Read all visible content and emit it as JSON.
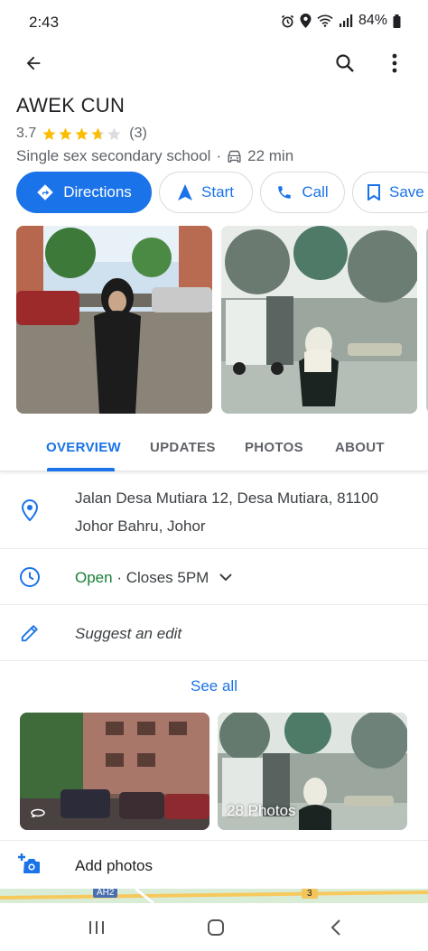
{
  "status_bar": {
    "time": "2:43",
    "battery": "84%"
  },
  "top_bar": {
    "back_icon": "arrow-back-icon",
    "search_icon": "search-icon",
    "menu_icon": "more-vert-icon"
  },
  "place": {
    "title": "AWEK CUN",
    "rating": "3.7",
    "review_count": "(3)",
    "rating_stars": 3.7,
    "category": "Single sex secondary school",
    "separator": "·",
    "travel_time": "22 min"
  },
  "actions": {
    "directions": "Directions",
    "start": "Start",
    "call": "Call",
    "save": "Save"
  },
  "tabs": {
    "overview": "OVERVIEW",
    "updates": "UPDATES",
    "photos": "PHOTOS",
    "about": "ABOUT"
  },
  "info": {
    "address_line1": "Jalan Desa Mutiara 12, Desa Mutiara, 81100",
    "address_line2": "Johor Bahru, Johor",
    "hours_status": "Open",
    "hours_detail": " · Closes 5PM",
    "suggest_edit": "Suggest an edit"
  },
  "see_all": "See all",
  "gallery": {
    "photo_count_label": "28 Photos"
  },
  "add_photos": "Add photos",
  "map_labels": {
    "road_a": "AH2",
    "road_b": "3"
  },
  "colors": {
    "accent": "#1a73e8",
    "open_green": "#188038",
    "star": "#fbbc04"
  }
}
